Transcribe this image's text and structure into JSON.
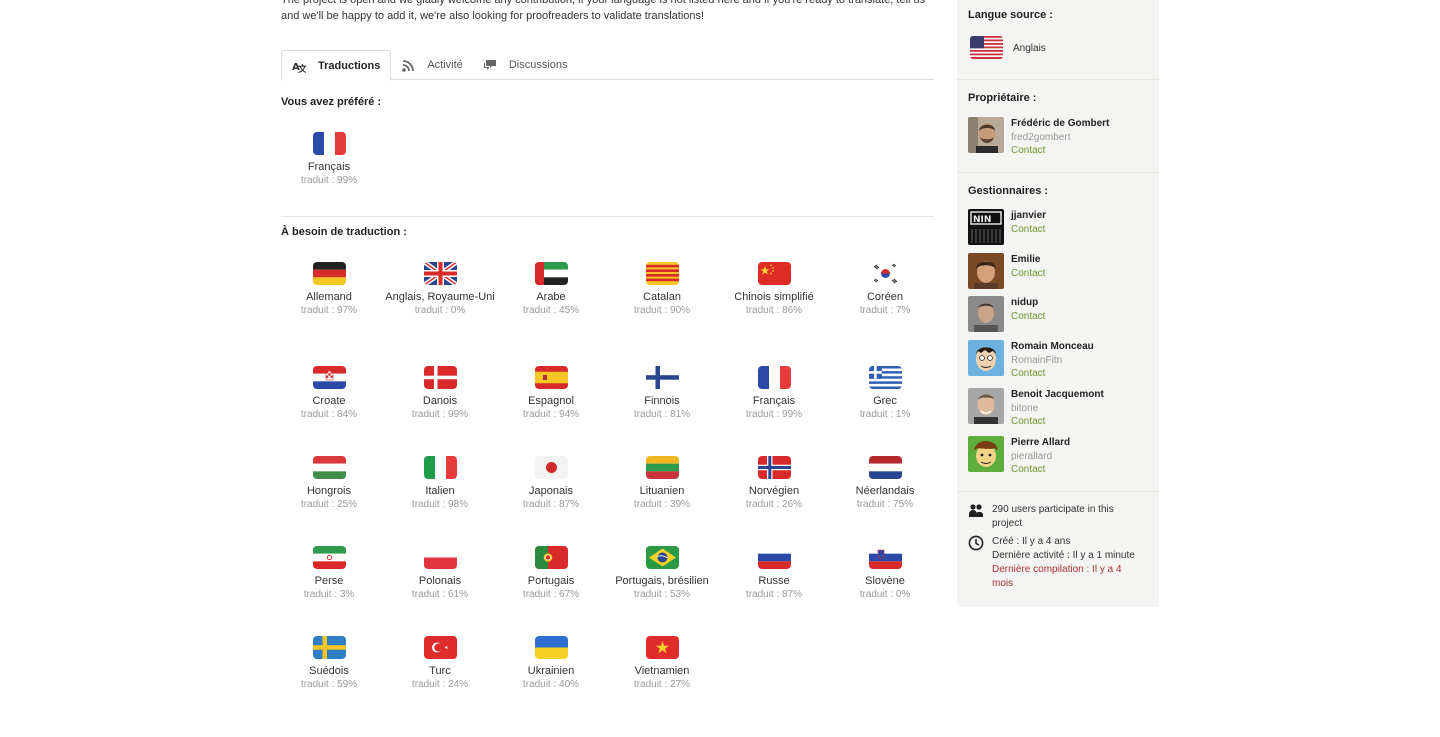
{
  "intro": "The project is open and we gladly welcome any contribution, if your language is not listed here and if you're ready to translate, tell us and we'll be happy to add it, we're also looking for proofreaders to validate translations!",
  "tabs": [
    {
      "label": "Traductions",
      "icon": "translate-icon"
    },
    {
      "label": "Activité",
      "icon": "rss-icon"
    },
    {
      "label": "Discussions",
      "icon": "comments-icon"
    }
  ],
  "preferred": {
    "title": "Vous avez préféré :",
    "items": [
      {
        "name": "Français",
        "pct": "traduit : 99%",
        "flag": "fr"
      }
    ]
  },
  "needs": {
    "title": "À besoin de traduction :",
    "items": [
      {
        "name": "Allemand",
        "pct": "traduit : 97%",
        "flag": "de"
      },
      {
        "name": "Anglais, Royaume-Uni",
        "pct": "traduit : 0%",
        "flag": "gb"
      },
      {
        "name": "Arabe",
        "pct": "traduit : 45%",
        "flag": "ae"
      },
      {
        "name": "Catalan",
        "pct": "traduit : 90%",
        "flag": "ca"
      },
      {
        "name": "Chinois simplifié",
        "pct": "traduit : 86%",
        "flag": "cn"
      },
      {
        "name": "Coréen",
        "pct": "traduit : 7%",
        "flag": "kr"
      },
      {
        "name": "Croate",
        "pct": "traduit : 84%",
        "flag": "hr"
      },
      {
        "name": "Danois",
        "pct": "traduit : 99%",
        "flag": "dk"
      },
      {
        "name": "Espagnol",
        "pct": "traduit : 94%",
        "flag": "es"
      },
      {
        "name": "Finnois",
        "pct": "traduit : 81%",
        "flag": "fi"
      },
      {
        "name": "Français",
        "pct": "traduit : 99%",
        "flag": "fr"
      },
      {
        "name": "Grec",
        "pct": "traduit : 1%",
        "flag": "gr"
      },
      {
        "name": "Hongrois",
        "pct": "traduit : 25%",
        "flag": "hu"
      },
      {
        "name": "Italien",
        "pct": "traduit : 98%",
        "flag": "it"
      },
      {
        "name": "Japonais",
        "pct": "traduit : 87%",
        "flag": "jp"
      },
      {
        "name": "Lituanien",
        "pct": "traduit : 39%",
        "flag": "lt"
      },
      {
        "name": "Norvégien",
        "pct": "traduit : 26%",
        "flag": "no"
      },
      {
        "name": "Néerlandais",
        "pct": "traduit : 75%",
        "flag": "nl"
      },
      {
        "name": "Perse",
        "pct": "traduit : 3%",
        "flag": "ir"
      },
      {
        "name": "Polonais",
        "pct": "traduit : 61%",
        "flag": "pl"
      },
      {
        "name": "Portugais",
        "pct": "traduit : 67%",
        "flag": "pt"
      },
      {
        "name": "Portugais, brésilien",
        "pct": "traduit : 53%",
        "flag": "br"
      },
      {
        "name": "Russe",
        "pct": "traduit : 87%",
        "flag": "ru"
      },
      {
        "name": "Slovène",
        "pct": "traduit : 0%",
        "flag": "si"
      },
      {
        "name": "Suédois",
        "pct": "traduit : 59%",
        "flag": "se"
      },
      {
        "name": "Turc",
        "pct": "traduit : 24%",
        "flag": "tr"
      },
      {
        "name": "Ukrainien",
        "pct": "traduit : 40%",
        "flag": "ua"
      },
      {
        "name": "Vietnamien",
        "pct": "traduit : 27%",
        "flag": "vn"
      }
    ]
  },
  "sidebar": {
    "source_title": "Langue source :",
    "source_lang": "Anglais",
    "owner_title": "Propriétaire :",
    "owner": {
      "name": "Frédéric de Gombert",
      "user": "fred2gombert",
      "contact": "Contact"
    },
    "managers_title": "Gestionnaires :",
    "managers": [
      {
        "name": "jjanvier",
        "user": "",
        "contact": "Contact",
        "avatar": "nin"
      },
      {
        "name": "Emilie",
        "user": "",
        "contact": "Contact",
        "avatar": "woman"
      },
      {
        "name": "nidup",
        "user": "",
        "contact": "Contact",
        "avatar": "man"
      },
      {
        "name": "Romain Monceau",
        "user": "RomainFitn",
        "contact": "Contact",
        "avatar": "cartoon"
      },
      {
        "name": "Benoit Jacquemont",
        "user": "bitone",
        "contact": "Contact",
        "avatar": "man2"
      },
      {
        "name": "Pierre Allard",
        "user": "pierallard",
        "contact": "Contact",
        "avatar": "drawing"
      }
    ],
    "users_text_1": "290 users participate in this",
    "users_text_2": "project",
    "created": "Créé : Il y a 4 ans",
    "last_activity": "Dernière activité : Il y a 1 minute",
    "last_build_1": "Dernière compilation : Il y a 4",
    "last_build_2": "mois"
  }
}
